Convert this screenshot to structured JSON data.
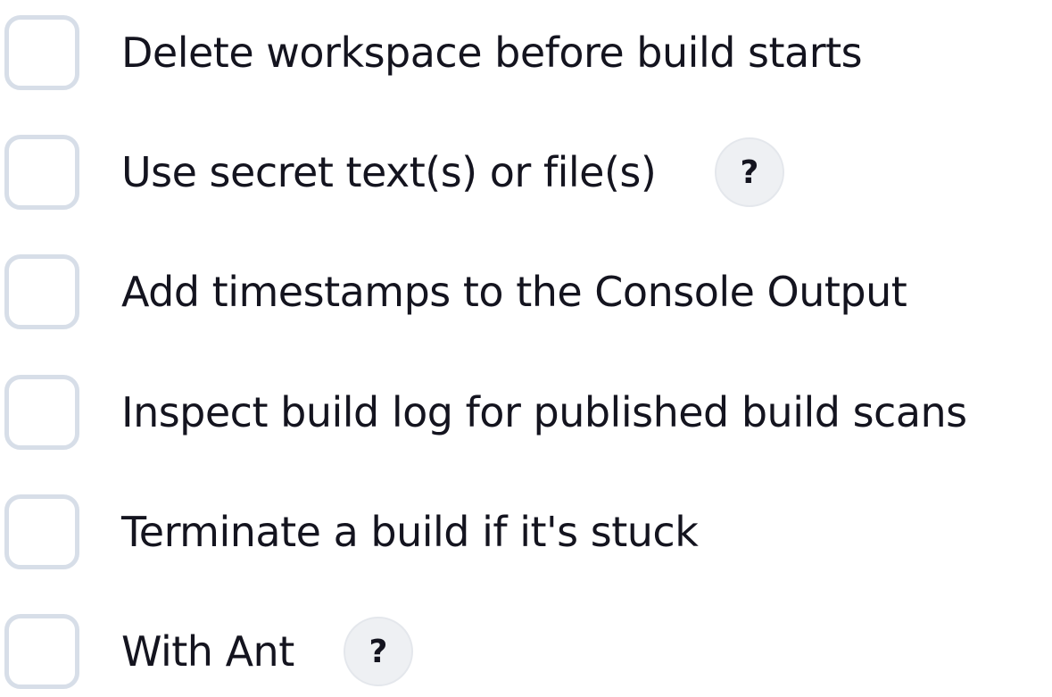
{
  "options": [
    {
      "label": "Delete workspace before build starts",
      "checked": false
    },
    {
      "label": "Use secret text(s) or file(s)",
      "checked": false,
      "help": "?"
    },
    {
      "label": "Add timestamps to the Console Output",
      "checked": false
    },
    {
      "label": "Inspect build log for published build scans",
      "checked": false
    },
    {
      "label": "Terminate a build if it's stuck",
      "checked": false
    },
    {
      "label": "With Ant",
      "checked": false,
      "help": "?"
    }
  ],
  "colors": {
    "checkbox_border": "#d7dee8",
    "help_bg": "#eef0f3",
    "text": "#14141f"
  }
}
